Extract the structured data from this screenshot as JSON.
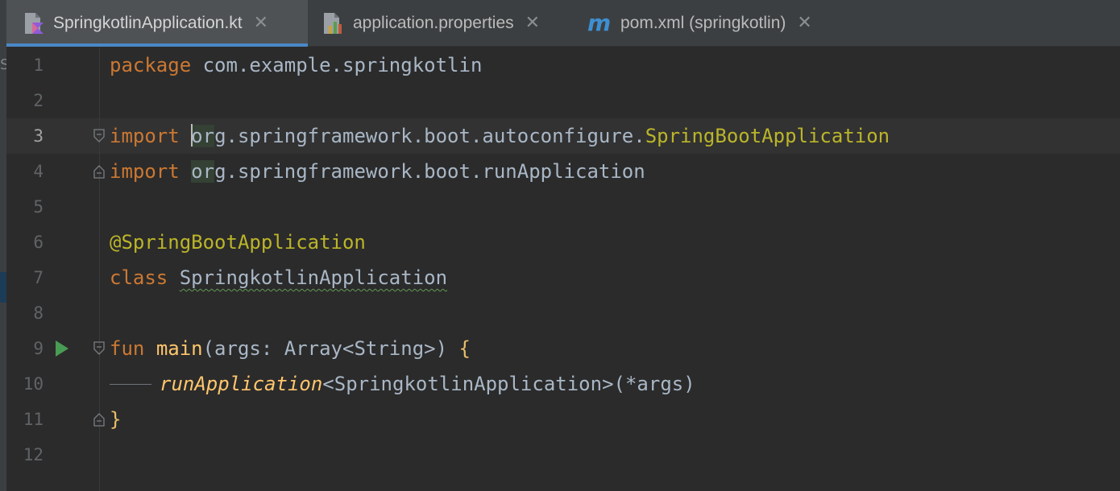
{
  "tabs": [
    {
      "label": "SpringkotlinApplication.kt",
      "icon": "kotlin-file-icon",
      "active": true
    },
    {
      "label": "application.properties",
      "icon": "properties-file-icon",
      "active": false
    },
    {
      "label": "pom.xml (springkotlin)",
      "icon": "maven-icon",
      "active": false
    }
  ],
  "close_glyph": "✕",
  "edge_letter": "S",
  "line_numbers": [
    "1",
    "2",
    "3",
    "4",
    "5",
    "6",
    "7",
    "8",
    "9",
    "10",
    "11",
    "12"
  ],
  "current_line": "3",
  "code": {
    "l1_kw": "package",
    "l1_rest": " com.example.springkotlin",
    "l3_kw": "import",
    "l3_pkg_head": "or",
    "l3_pkg": "g.springframework.boot.autoconfigure.",
    "l3_cls": "SpringBootApplication",
    "l4_kw": "import",
    "l4_pkg_head": "or",
    "l4_pkg": "g.springframework.boot.runApplication",
    "l6_ann": "@SpringBootApplication",
    "l7_kw": "class",
    "l7_name": "SpringkotlinApplication",
    "l9_kw": "fun",
    "l9_fn": "main",
    "l9_args": "(args: Array<String>) ",
    "l9_brace": "{",
    "l10_fn": "runApplication",
    "l10_rest": "<SpringkotlinApplication>(*args)",
    "l11_brace": "}"
  },
  "colors": {
    "background": "#2b2b2b",
    "keyword": "#cc7832",
    "annotation": "#bbb529",
    "function": "#ffc66d",
    "text": "#a9b7c6",
    "accent": "#4a88c7",
    "run": "#499c54"
  }
}
